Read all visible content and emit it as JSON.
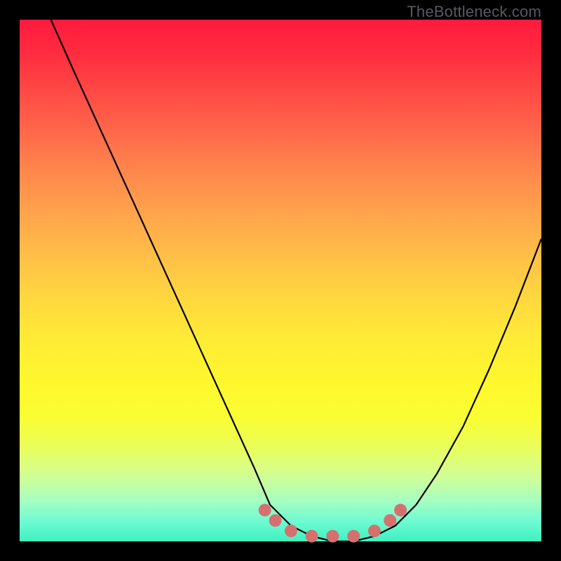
{
  "watermark": "TheBottleneck.com",
  "chart_data": {
    "type": "line",
    "title": "",
    "xlabel": "",
    "ylabel": "",
    "xlim": [
      0,
      100
    ],
    "ylim": [
      0,
      100
    ],
    "grid": false,
    "series": [
      {
        "name": "bottleneck-curve",
        "color": "#000000",
        "x": [
          6,
          10,
          15,
          20,
          25,
          30,
          35,
          40,
          45,
          48,
          52,
          56,
          60,
          64,
          68,
          72,
          76,
          80,
          85,
          90,
          95,
          100
        ],
        "values": [
          100,
          91,
          80,
          69,
          58,
          47,
          36,
          25,
          14,
          7,
          3,
          1,
          0,
          0,
          1,
          3,
          7,
          13,
          22,
          33,
          45,
          58
        ]
      },
      {
        "name": "optimal-range-markers",
        "color": "#d6706f",
        "x": [
          47,
          49,
          52,
          56,
          60,
          64,
          68,
          71,
          73
        ],
        "values": [
          6,
          4,
          2,
          1,
          1,
          1,
          2,
          4,
          6
        ]
      }
    ]
  },
  "colors": {
    "background": "#000000",
    "curve": "#000000",
    "markers": "#d6706f",
    "gradient_top": "#ff1a3e",
    "gradient_mid": "#ffec35",
    "gradient_bottom": "#3df1c2",
    "watermark": "#555b5e"
  }
}
